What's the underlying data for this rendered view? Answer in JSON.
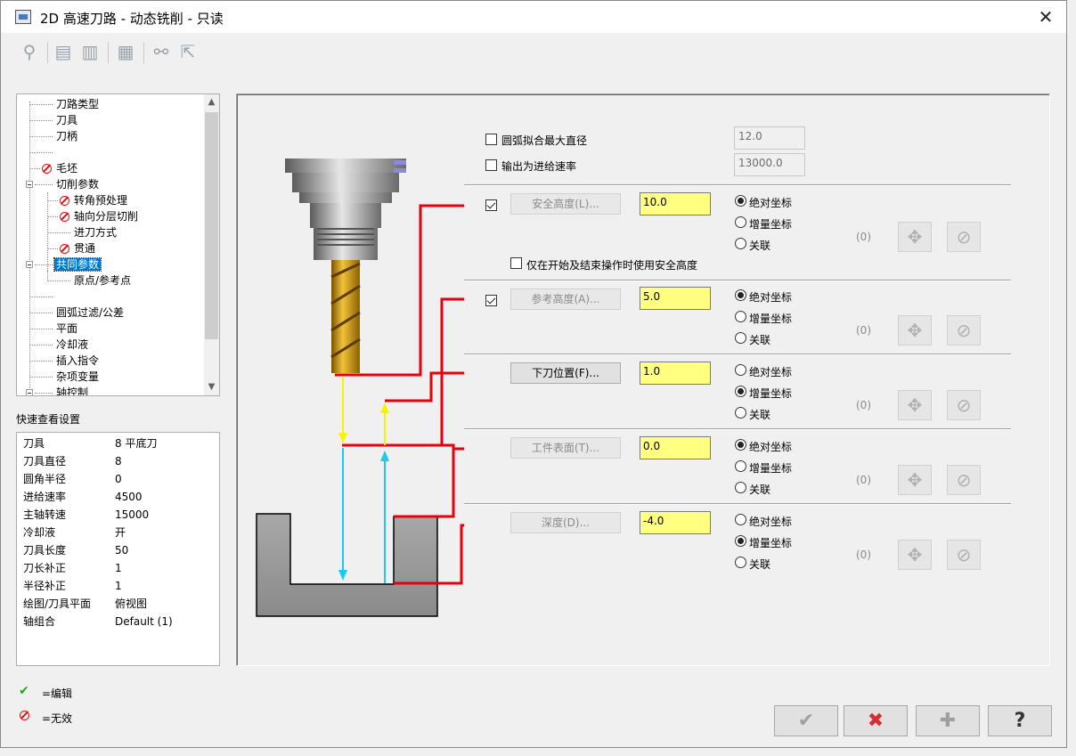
{
  "window": {
    "title": "2D 高速刀路 - 动态铣削 - 只读",
    "close": "✕"
  },
  "toolbar": {
    "icons": [
      "tool-icon",
      "save-icon",
      "save-as-icon",
      "calculator-icon",
      "preview-icon",
      "export-icon"
    ]
  },
  "tree": {
    "items": [
      {
        "label": "刀路类型",
        "invalid": false
      },
      {
        "label": "刀具",
        "invalid": false
      },
      {
        "label": "刀柄",
        "invalid": false
      },
      {
        "label": "",
        "invalid": false
      },
      {
        "label": "毛坯",
        "invalid": true
      },
      {
        "label": "切削参数",
        "invalid": false
      },
      {
        "label": "转角预处理",
        "invalid": true
      },
      {
        "label": "轴向分层切削",
        "invalid": true
      },
      {
        "label": "进刀方式",
        "invalid": false
      },
      {
        "label": "贯通",
        "invalid": true
      },
      {
        "label": "共同参数",
        "invalid": false,
        "selected": true
      },
      {
        "label": "原点/参考点",
        "invalid": false
      },
      {
        "label": "",
        "invalid": false
      },
      {
        "label": "圆弧过滤/公差",
        "invalid": false
      },
      {
        "label": "平面",
        "invalid": false
      },
      {
        "label": "冷却液",
        "invalid": false
      },
      {
        "label": "插入指令",
        "invalid": false
      },
      {
        "label": "杂项变量",
        "invalid": false
      },
      {
        "label": "轴控制",
        "invalid": false
      }
    ]
  },
  "quick_view": {
    "title": "快速查看设置",
    "rows": [
      {
        "k": "刀具",
        "v": "8 平底刀"
      },
      {
        "k": "刀具直径",
        "v": "8"
      },
      {
        "k": "圆角半径",
        "v": "0"
      },
      {
        "k": "进给速率",
        "v": "4500"
      },
      {
        "k": "主轴转速",
        "v": "15000"
      },
      {
        "k": "冷却液",
        "v": "开"
      },
      {
        "k": "刀具长度",
        "v": "50"
      },
      {
        "k": "刀长补正",
        "v": "1"
      },
      {
        "k": "半径补正",
        "v": "1"
      },
      {
        "k": "绘图/刀具平面",
        "v": "俯视图"
      },
      {
        "k": "轴组合",
        "v": "Default (1)"
      }
    ]
  },
  "legend": {
    "edit_mark": "✔",
    "edit": "=编辑",
    "invalid": "=无效"
  },
  "panel": {
    "arc_fit": {
      "label": "圆弧拟合最大直径",
      "value": "12.0",
      "checked": false
    },
    "output_feed": {
      "label": "输出为进给速率",
      "value": "13000.0",
      "checked": false
    },
    "only_start_end": {
      "label": "仅在开始及结束操作时使用安全高度",
      "checked": false
    },
    "radio_labels": {
      "abs": "绝对坐标",
      "inc": "增量坐标",
      "assoc": "关联"
    },
    "rows": [
      {
        "button": "安全高度(L)...",
        "value": "10.0",
        "checked": true,
        "enabled": false,
        "mode": "abs",
        "zero": "(0)"
      },
      {
        "button": "参考高度(A)...",
        "value": "5.0",
        "checked": true,
        "enabled": false,
        "mode": "abs",
        "zero": "(0)"
      },
      {
        "button": "下刀位置(F)...",
        "value": "1.0",
        "checked": null,
        "enabled": true,
        "mode": "inc",
        "zero": "(0)"
      },
      {
        "button": "工件表面(T)...",
        "value": "0.0",
        "checked": null,
        "enabled": false,
        "mode": "abs",
        "zero": "(0)"
      },
      {
        "button": "深度(D)...",
        "value": "-4.0",
        "checked": null,
        "enabled": false,
        "mode": "inc",
        "zero": "(0)"
      }
    ]
  },
  "bottom": {
    "ok": "✔",
    "cancel": "✖",
    "add": "✚",
    "help": "?"
  },
  "colors": {
    "accent": "#0078d7",
    "field": "#ffff80",
    "red_line": "#e8000b",
    "yellow_arrow": "#f5f500",
    "cyan_arrow": "#1ec8f0"
  }
}
